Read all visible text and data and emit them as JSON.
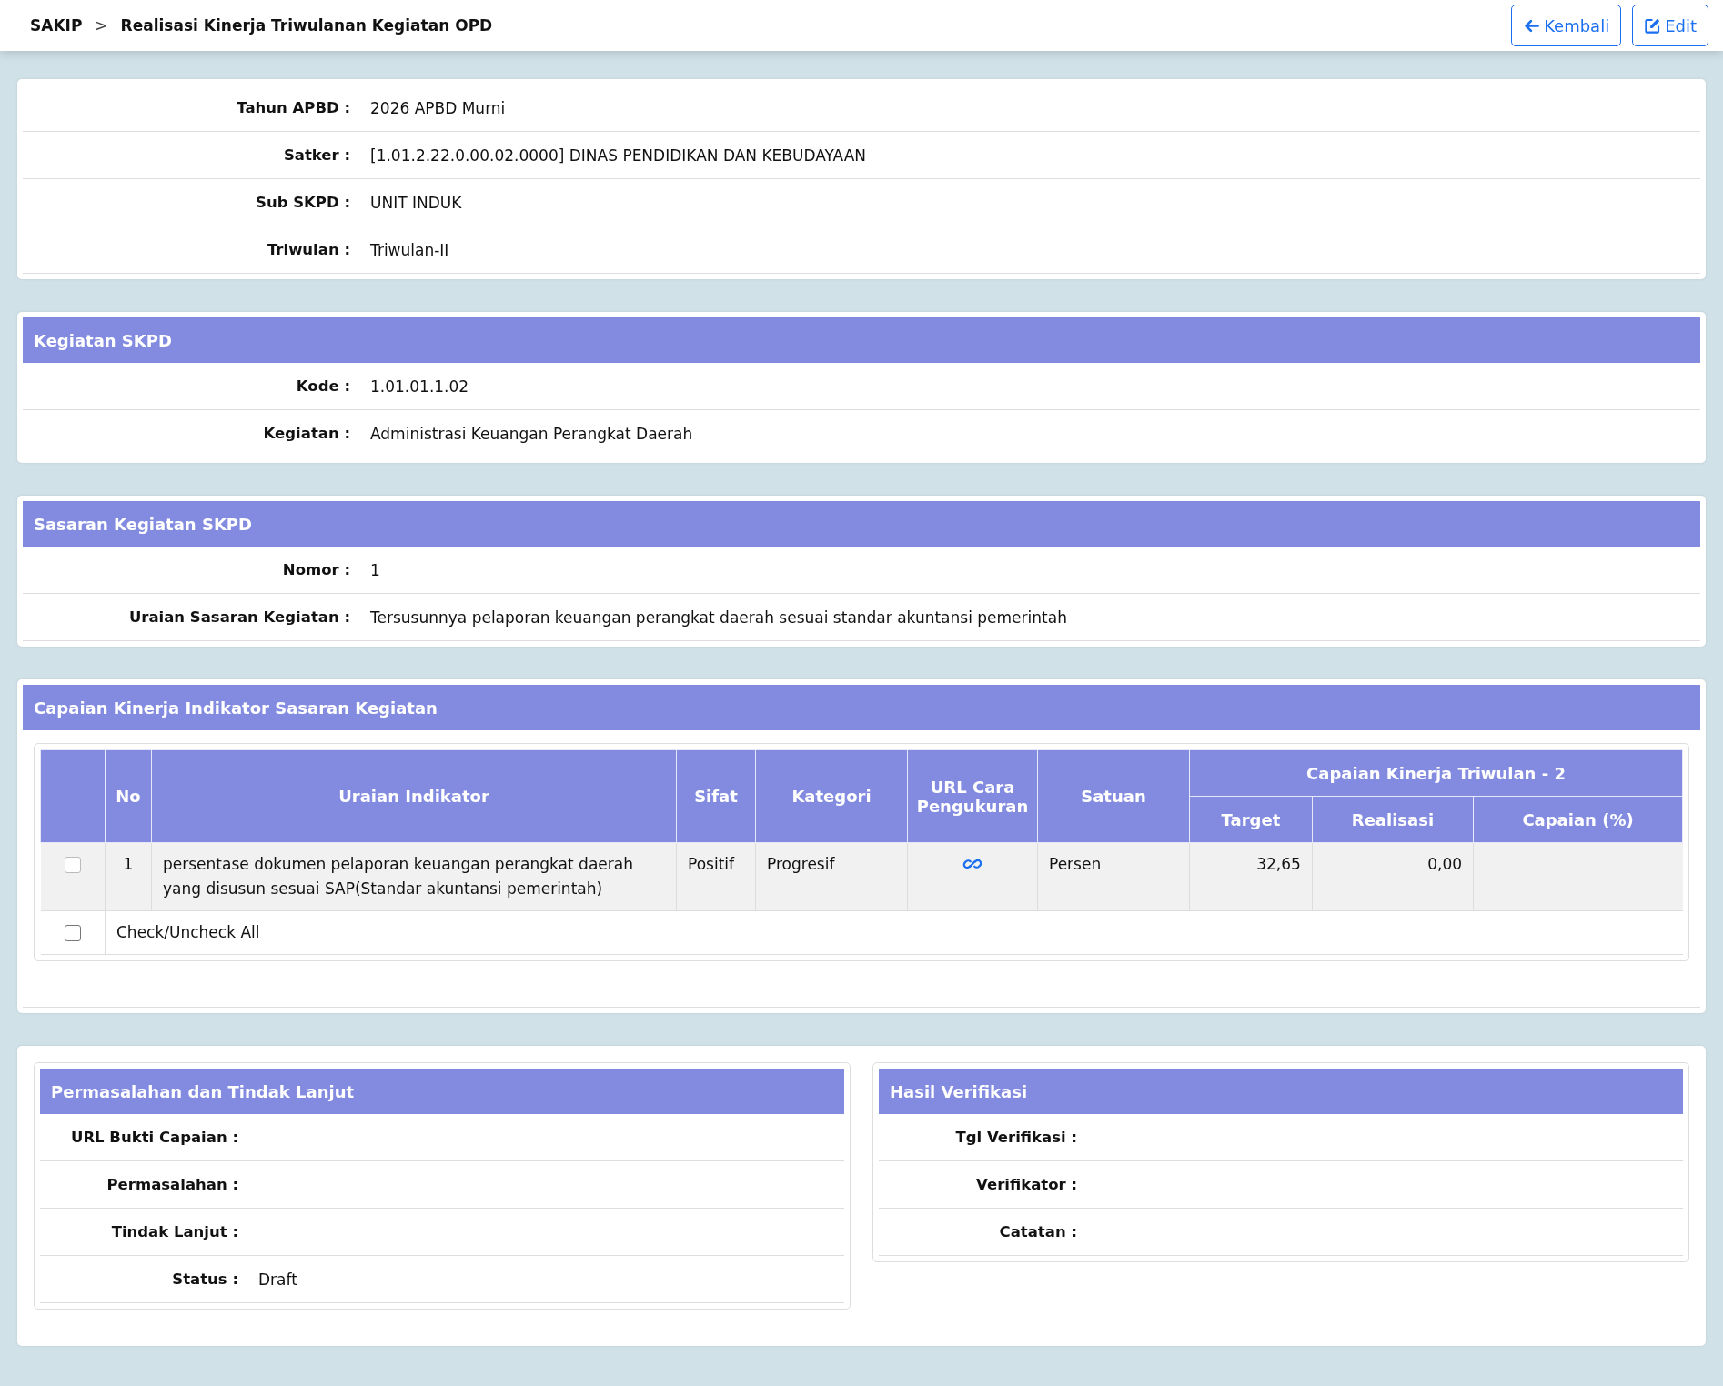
{
  "breadcrumb": {
    "root": "SAKIP",
    "separator": ">",
    "current": "Realisasi Kinerja Triwulanan Kegiatan OPD"
  },
  "actions": [
    {
      "label": "Kembali"
    },
    {
      "label": "Edit"
    }
  ],
  "info": [
    {
      "label": "Tahun APBD :",
      "value": "2026 APBD Murni"
    },
    {
      "label": "Satker :",
      "value": "[1.01.2.22.0.00.02.0000] DINAS PENDIDIKAN DAN KEBUDAYAAN"
    },
    {
      "label": "Sub SKPD :",
      "value": "UNIT INDUK"
    },
    {
      "label": "Triwulan :",
      "value": "Triwulan-II"
    }
  ],
  "kegiatan": {
    "title": "Kegiatan SKPD",
    "fields": [
      {
        "label": "Kode :",
        "value": "1.01.01.1.02"
      },
      {
        "label": "Kegiatan :",
        "value": "Administrasi Keuangan Perangkat Daerah"
      }
    ]
  },
  "sasaran": {
    "title": "Sasaran Kegiatan SKPD",
    "fields": [
      {
        "label": "Nomor :",
        "value": "1"
      },
      {
        "label": "Uraian Sasaran Kegiatan :",
        "value": "Tersusunnya pelaporan keuangan perangkat daerah sesuai standar akuntansi pemerintah"
      }
    ]
  },
  "capaian": {
    "title": "Capaian Kinerja Indikator Sasaran Kegiatan",
    "columns": [
      "No",
      "Uraian Indikator",
      "Sifat",
      "Kategori",
      "URL Cara Pengukuran",
      "Satuan"
    ],
    "group_header": "Capaian Kinerja Triwulan - 2",
    "sub_columns": [
      "Target",
      "Realisasi",
      "Capaian (%)"
    ],
    "rows": [
      {
        "checked": false,
        "disabled": true,
        "no": "1",
        "uraian": "persentase dokumen pelaporan keuangan perangkat daerah yang disusun sesuai SAP(Standar akuntansi pemerintah)",
        "sifat": "Positif",
        "kategori": "Progresif",
        "satuan": "Persen",
        "target": "32,65",
        "realisasi": "0,00"
      }
    ],
    "check_all": {
      "label": "Check/Uncheck All",
      "checked": false,
      "disabled": false
    }
  },
  "permasalahan": {
    "title": "Permasalahan dan Tindak Lanjut",
    "fields": [
      {
        "label": "URL Bukti Capaian :"
      },
      {
        "label": "Permasalahan :"
      },
      {
        "label": "Tindak Lanjut :"
      },
      {
        "label": "Status :",
        "value": "Draft"
      }
    ]
  },
  "verifikasi": {
    "title": "Hasil Verifikasi",
    "fields": [
      {
        "label": "Tgl Verifikasi :"
      },
      {
        "label": "Verifikator :"
      },
      {
        "label": "Catatan :"
      }
    ]
  }
}
